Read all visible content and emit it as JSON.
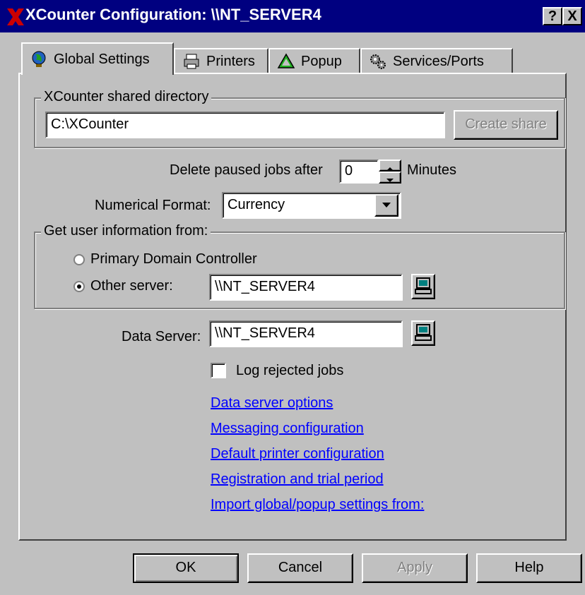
{
  "window": {
    "title": "XCounter Configuration: \\\\NT_SERVER4",
    "help_label": "?",
    "close_label": "X"
  },
  "tabs": [
    {
      "label": "Global Settings",
      "icon": "globe-icon"
    },
    {
      "label": "Printers",
      "icon": "printer-icon"
    },
    {
      "label": "Popup",
      "icon": "triangle-icon"
    },
    {
      "label": "Services/Ports",
      "icon": "gears-icon"
    }
  ],
  "shared_directory": {
    "legend": "XCounter shared directory",
    "value": "C:\\XCounter",
    "create_share_label": "Create share"
  },
  "delete_paused": {
    "label": "Delete paused jobs after",
    "value": "0",
    "unit": "Minutes"
  },
  "numerical_format": {
    "label": "Numerical Format:",
    "value": "Currency"
  },
  "user_info": {
    "legend": "Get user information from:",
    "primary_label": "Primary Domain Controller",
    "other_label": "Other server:",
    "other_value": "\\\\NT_SERVER4",
    "selected": "other"
  },
  "data_server": {
    "label": "Data Server:",
    "value": "\\\\NT_SERVER4"
  },
  "log_rejected": {
    "label": "Log rejected jobs",
    "checked": false
  },
  "links": [
    "Data server options",
    "Messaging configuration",
    "Default printer configuration",
    "Registration and trial period",
    "Import global/popup settings from:"
  ],
  "buttons": {
    "ok": "OK",
    "cancel": "Cancel",
    "apply": "Apply",
    "help": "Help"
  },
  "colors": {
    "title_bar": "#000080",
    "face": "#c0c0c0",
    "link": "#0000ff",
    "logo_red": "#cc0000"
  }
}
